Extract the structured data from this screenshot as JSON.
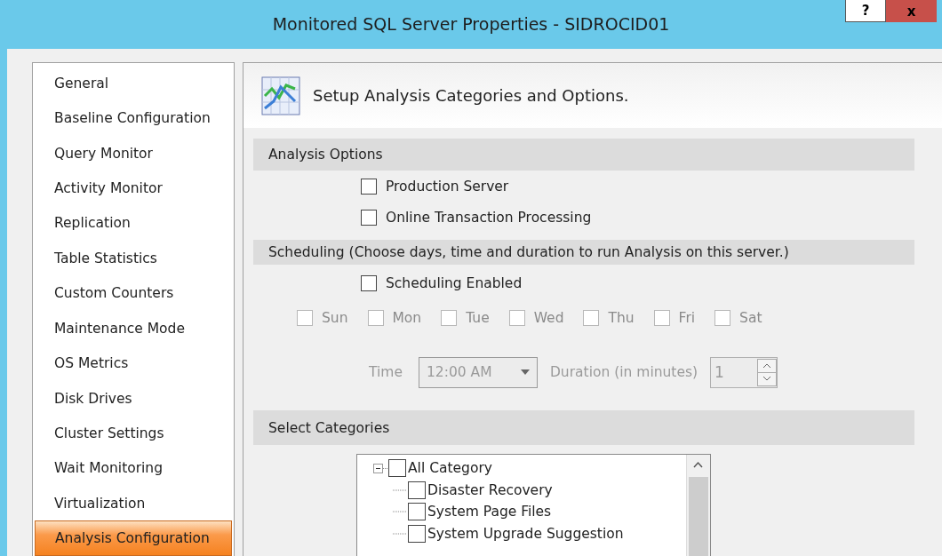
{
  "window": {
    "title": "Monitored SQL Server Properties - SIDROCID01",
    "help_label": "?",
    "close_label": "x"
  },
  "sidebar": {
    "items": [
      {
        "label": "General",
        "selected": false
      },
      {
        "label": "Baseline Configuration",
        "selected": false
      },
      {
        "label": "Query Monitor",
        "selected": false
      },
      {
        "label": "Activity Monitor",
        "selected": false
      },
      {
        "label": "Replication",
        "selected": false
      },
      {
        "label": "Table Statistics",
        "selected": false
      },
      {
        "label": "Custom Counters",
        "selected": false
      },
      {
        "label": "Maintenance Mode",
        "selected": false
      },
      {
        "label": "OS Metrics",
        "selected": false
      },
      {
        "label": "Disk Drives",
        "selected": false
      },
      {
        "label": "Cluster Settings",
        "selected": false
      },
      {
        "label": "Wait Monitoring",
        "selected": false
      },
      {
        "label": "Virtualization",
        "selected": false
      },
      {
        "label": "Analysis Configuration",
        "selected": true
      }
    ]
  },
  "header": {
    "title": "Setup Analysis Categories and Options."
  },
  "analysis_options": {
    "title": "Analysis Options",
    "options": [
      {
        "label": "Production Server",
        "checked": false
      },
      {
        "label": "Online Transaction Processing",
        "checked": false
      }
    ]
  },
  "scheduling": {
    "title": "Scheduling (Choose days, time and duration to run Analysis on this server.)",
    "enabled": {
      "label": "Scheduling Enabled",
      "checked": false
    },
    "days": [
      {
        "label": "Sun",
        "checked": false,
        "disabled": true
      },
      {
        "label": "Mon",
        "checked": false,
        "disabled": true
      },
      {
        "label": "Tue",
        "checked": false,
        "disabled": true
      },
      {
        "label": "Wed",
        "checked": false,
        "disabled": true
      },
      {
        "label": "Thu",
        "checked": false,
        "disabled": true
      },
      {
        "label": "Fri",
        "checked": false,
        "disabled": true
      },
      {
        "label": "Sat",
        "checked": false,
        "disabled": true
      }
    ],
    "time_label": "Time",
    "time_value": "12:00 AM",
    "duration_label": "Duration (in minutes)",
    "duration_value": "1",
    "disabled": true
  },
  "categories": {
    "title": "Select Categories",
    "tree": [
      {
        "label": "All Category",
        "checked": false,
        "expanded": true,
        "children": [
          {
            "label": "Disaster Recovery",
            "checked": false
          },
          {
            "label": "System Page Files",
            "checked": false
          },
          {
            "label": "System Upgrade Suggestion",
            "checked": false
          }
        ]
      }
    ]
  }
}
